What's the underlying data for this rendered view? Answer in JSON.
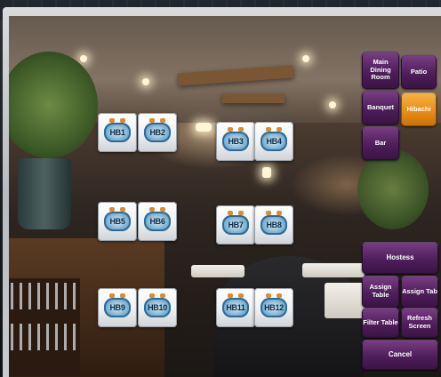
{
  "tables": [
    {
      "label": "HB1"
    },
    {
      "label": "HB2"
    },
    {
      "label": "HB3"
    },
    {
      "label": "HB4"
    },
    {
      "label": "HB5"
    },
    {
      "label": "HB6"
    },
    {
      "label": "HB7"
    },
    {
      "label": "HB8"
    },
    {
      "label": "HB9"
    },
    {
      "label": "HB10"
    },
    {
      "label": "HB11"
    },
    {
      "label": "HB12"
    }
  ],
  "areas": [
    {
      "label": "Main Dining Room",
      "active": false
    },
    {
      "label": "Patio",
      "active": false
    },
    {
      "label": "Banquet",
      "active": false
    },
    {
      "label": "Hibachi",
      "active": true
    },
    {
      "label": "Bar",
      "active": false
    }
  ],
  "actions": {
    "hostess": "Hostess",
    "assign_table": "Assign Table",
    "assign_tab": "Assign Tab",
    "filter_table": "Filter Table",
    "refresh_screen": "Refresh Screen",
    "cancel": "Cancel"
  },
  "colors": {
    "button_purple": "#4e1e5a",
    "button_active_orange": "#e88f17",
    "table_seat_blue": "#2f6f9a"
  },
  "icons": {
    "table_icon": "hibachi-table-icon"
  }
}
